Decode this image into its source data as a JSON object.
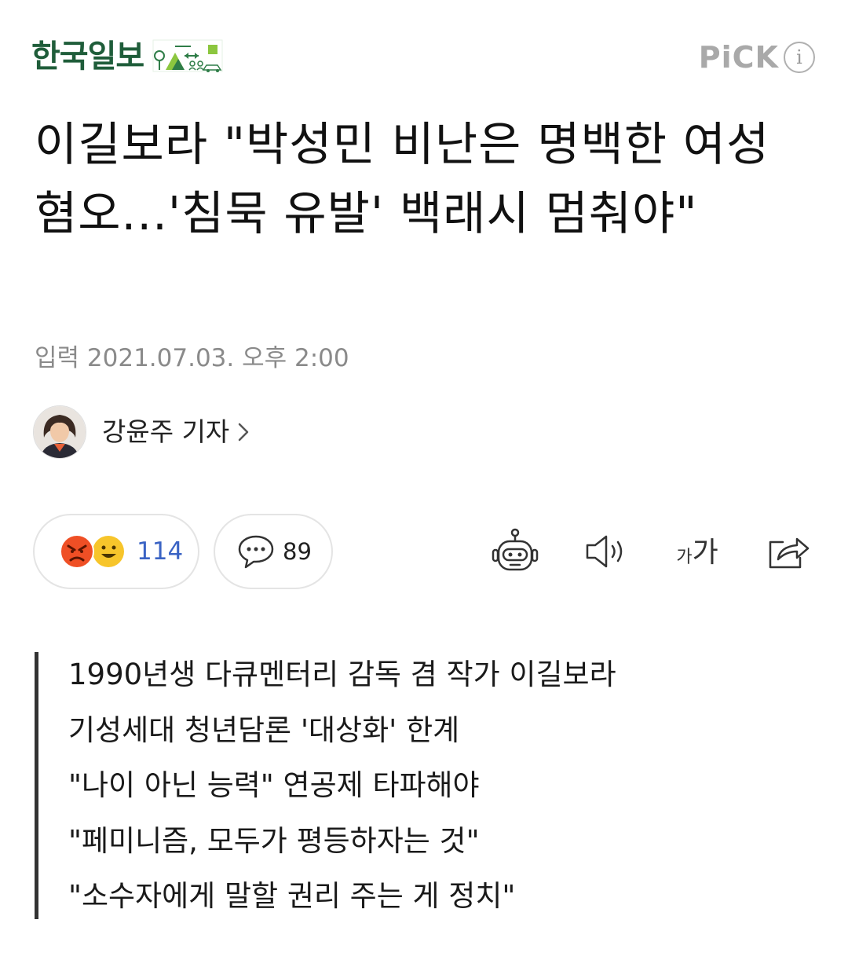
{
  "header": {
    "brand_name": "한국일보",
    "brand_logo_icon": "nature-scene-logo",
    "pick_label": "PiCK",
    "info_icon": "info-icon",
    "brand_color": "#1f5d3a"
  },
  "article": {
    "headline": "이길보라 \"박성민 비난은 명백한 여성혐오...'침묵 유발' 백래시 멈춰야\"",
    "date": "입력 2021.07.03. 오후 2:00",
    "reporter_name": "강윤주 기자"
  },
  "actions": {
    "reaction_count": "114",
    "comment_count": "89",
    "font_size_small": "가",
    "font_size_large": "가",
    "accent_color": "#3a63c4"
  },
  "summary": [
    "1990년생 다큐멘터리 감독 겸 작가 이길보라",
    "기성세대 청년담론 '대상화' 한계",
    "\"나이 아닌 능력\" 연공제 타파해야",
    "\"페미니즘, 모두가 평등하자는 것\"",
    "\"소수자에게 말할 권리 주는 게 정치\""
  ]
}
